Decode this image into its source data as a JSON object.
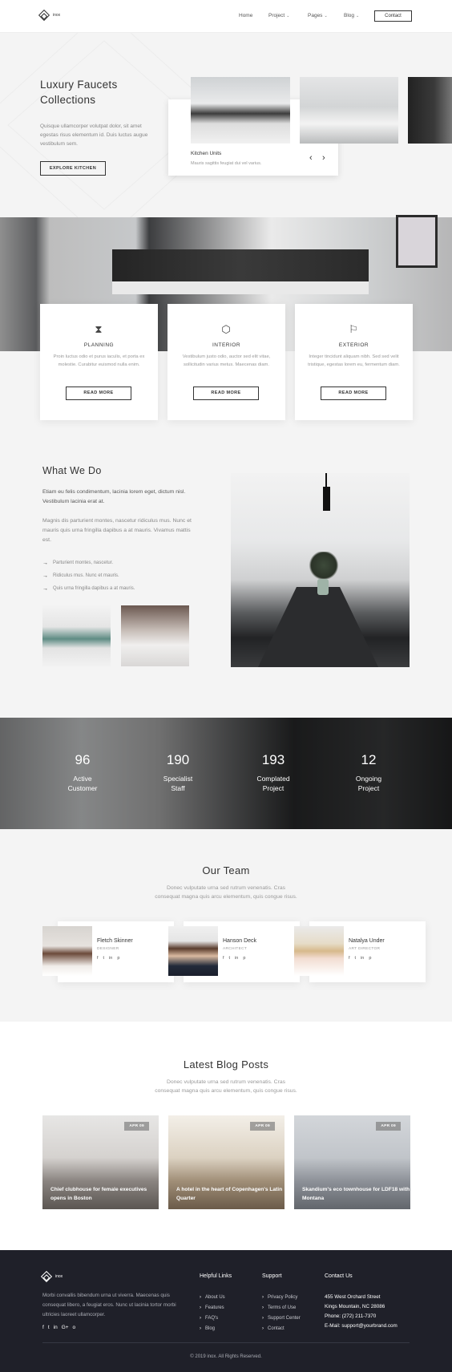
{
  "header": {
    "brand": "inox",
    "nav": [
      {
        "label": "Home",
        "has_dropdown": false
      },
      {
        "label": "Project",
        "has_dropdown": true
      },
      {
        "label": "Pages",
        "has_dropdown": true
      },
      {
        "label": "Blog",
        "has_dropdown": true
      }
    ],
    "contact_label": "Contact"
  },
  "hero": {
    "title": "Luxury Faucets Collections",
    "text": "Quisque ullamcorper volutpat dolor, sit amet egestas risus elementum id. Duis luctus augue vestibulum sem.",
    "button_label": "EXPLORE KITCHEN",
    "card": {
      "title": "Kitchen Units",
      "subtitle": "Mauris sagittis feugiat dui vel varius.",
      "prev_icon": "chevron-left-icon",
      "next_icon": "chevron-right-icon"
    }
  },
  "services": [
    {
      "icon": "hourglass-icon",
      "title": "PLANNING",
      "text": "Proin luctus odio et purus iaculis, et porta ex molestie. Curabitur euismod nulla enim.",
      "button": "READ MORE"
    },
    {
      "icon": "hexagon-icon",
      "title": "INTERIOR",
      "text": "Vestibulum justo odio, auctor sed elit vitae, sollicitudin varius metus. Maecenas diam.",
      "button": "READ MORE"
    },
    {
      "icon": "flag-icon",
      "title": "EXTERIOR",
      "text": "Integer tincidunt aliquam nibh. Sed sed velit tristique, egestas lorem eu, fermentum diam.",
      "button": "READ MORE"
    }
  ],
  "what_we_do": {
    "title": "What We Do",
    "p1": "Etiam eu felis condimentum, lacinia lorem eget, dictum nisl. Vestibulum lacinia erat at.",
    "p2": "Magnis dis parturient montes, nascetur ridiculus mus. Nunc et mauris quis urna fringilla dapibus a at mauris. Vivamus mattis est.",
    "list": [
      "Parturient montes, nascetur.",
      "Ridiculus mus. Nunc et mauris.",
      "Quis urna fringilla dapibus a at mauris."
    ]
  },
  "stats": [
    {
      "value": "96",
      "label_line1": "Active",
      "label_line2": "Customer"
    },
    {
      "value": "190",
      "label_line1": "Specialist",
      "label_line2": "Staff"
    },
    {
      "value": "193",
      "label_line1": "Complated",
      "label_line2": "Project"
    },
    {
      "value": "12",
      "label_line1": "Ongoing",
      "label_line2": "Project"
    }
  ],
  "team": {
    "title": "Our Team",
    "subtitle_line1": "Donec vulputate urna sed rutrum venenatis. Cras",
    "subtitle_line2": "consequat magna quis arcu elementum, quis congue risus.",
    "members": [
      {
        "name": "Fletch Skinner",
        "role": "DESIGNER"
      },
      {
        "name": "Hanson Deck",
        "role": "ARCHITECT"
      },
      {
        "name": "Natalya Under",
        "role": "ART DIRECTOR"
      }
    ],
    "social": [
      "f",
      "t",
      "in",
      "p"
    ]
  },
  "blog": {
    "title": "Latest Blog Posts",
    "subtitle_line1": "Donec vulputate urna sed rutrum venenatis. Cras",
    "subtitle_line2": "consequat magna quis arcu elementum, quis congue risus.",
    "posts": [
      {
        "date": "APR 09",
        "title": "Chief clubhouse for female executives opens in Boston"
      },
      {
        "date": "APR 09",
        "title": "A hotel in the heart of Copenhagen's Latin Quarter"
      },
      {
        "date": "APR 09",
        "title": "Skandium's eco townhouse for LDF18 with Montana"
      }
    ]
  },
  "footer": {
    "brand": "inox",
    "text": "Morbi convallis bibendum urna ut viverra. Maecenas quis consequat libero, a feugiat eros. Nunc ut lacinia tortor morbi ultricies laoreet ullamcorper.",
    "social": [
      "f",
      "t",
      "in",
      "G+",
      "o"
    ],
    "helpful_links": {
      "title": "Helpful Links",
      "items": [
        "About Us",
        "Features",
        "FAQ's",
        "Blog"
      ]
    },
    "support": {
      "title": "Support",
      "items": [
        "Privacy Policy",
        "Terms of Use",
        "Support Center",
        "Contact"
      ]
    },
    "contact": {
      "title": "Contact Us",
      "address1": "455 West Orchard Street",
      "address2": "Kings Mountain, NC 28086",
      "phone": "Phone: (272) 211-7370",
      "email": "E-Mail: support@yourbrand.com"
    },
    "copyright": "© 2019 inox. All Rights Reserved."
  }
}
